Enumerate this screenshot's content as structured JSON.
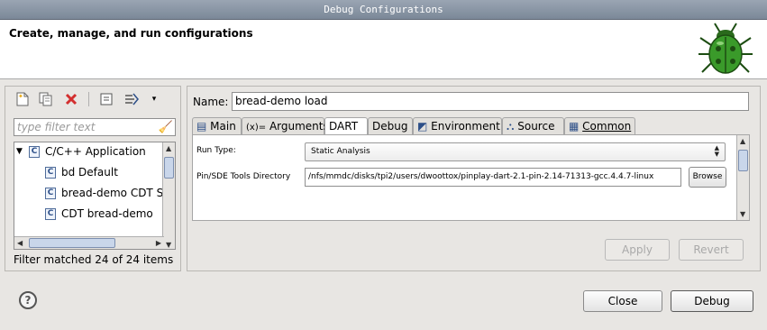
{
  "window": {
    "title": "Debug Configurations"
  },
  "header": {
    "title": "Create, manage, and run configurations"
  },
  "left": {
    "filter_placeholder": "type filter text",
    "tree": [
      {
        "label": "C/C++ Application",
        "expanded": true
      },
      {
        "label": "bd Default"
      },
      {
        "label": "bread-demo CDT S"
      },
      {
        "label": "CDT bread-demo"
      }
    ],
    "status": "Filter matched 24 of 24 items"
  },
  "right": {
    "name_label": "Name:",
    "name_value": "bread-demo load",
    "tabs": [
      "Main",
      "Arguments",
      "DART",
      "Debug",
      "Environment",
      "Source",
      "Common"
    ],
    "active_tab": "DART",
    "run_type_label": "Run Type:",
    "run_type_value": "Static Analysis",
    "pin_label": "Pin/SDE Tools Directory",
    "pin_value": "/nfs/mmdc/disks/tpi2/users/dwoottox/pinplay-dart-2.1-pin-2.14-71313-gcc.4.4.7-linux",
    "browse_label": "Browse",
    "apply_label": "Apply",
    "revert_label": "Revert"
  },
  "footer": {
    "close_label": "Close",
    "debug_label": "Debug",
    "help_glyph": "?"
  },
  "icons": [
    "new-config-icon",
    "duplicate-icon",
    "delete-icon",
    "collapse-all-icon",
    "filter-icon",
    "view-menu-icon",
    "clear-filter-icon",
    "bug-icon",
    "c-app-icon"
  ],
  "colors": {
    "delete_red": "#d32f2f",
    "accent_blue": "#2d4f88",
    "bug_green": "#3a9a2a"
  }
}
